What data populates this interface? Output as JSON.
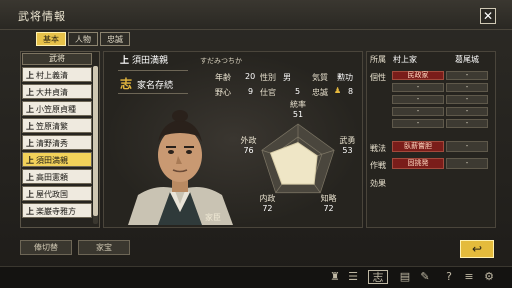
{
  "window": {
    "title": "武将情報",
    "close_label": "✕"
  },
  "tabs": [
    {
      "label": "基本",
      "active": true
    },
    {
      "label": "人物",
      "active": false
    },
    {
      "label": "忠誠",
      "active": false
    }
  ],
  "officer_list": {
    "header": "武将",
    "mark": "上",
    "items": [
      {
        "name": "村上義清",
        "selected": false
      },
      {
        "name": "大井貞清",
        "selected": false
      },
      {
        "name": "小笠原貞種",
        "selected": false
      },
      {
        "name": "笠原清繁",
        "selected": false
      },
      {
        "name": "清野清秀",
        "selected": false
      },
      {
        "name": "須田満親",
        "selected": true
      },
      {
        "name": "高田憲頼",
        "selected": false
      },
      {
        "name": "屋代政国",
        "selected": false
      },
      {
        "name": "楽巌寺雅方",
        "selected": false
      }
    ]
  },
  "officer": {
    "mark": "上",
    "name": "須田満親",
    "kana": "すだみつちか",
    "family_icon": "志",
    "family_text": "家名存続",
    "stats": [
      {
        "label": "年齢",
        "value": "20"
      },
      {
        "label": "性別",
        "value": "男"
      },
      {
        "label": "気質",
        "value": "勲功"
      },
      {
        "label": "野心",
        "value": "9"
      },
      {
        "label": "仕官",
        "value": "5"
      },
      {
        "label": "忠誠",
        "value": "8"
      }
    ],
    "portrait_caption": "家臣"
  },
  "radar": {
    "axes": [
      {
        "label": "統率",
        "value": 51
      },
      {
        "label": "武勇",
        "value": 53
      },
      {
        "label": "知略",
        "value": 72
      },
      {
        "label": "内政",
        "value": 72
      },
      {
        "label": "外政",
        "value": 76
      }
    ]
  },
  "affiliation": {
    "clan_label": "所属",
    "clan_value": "村上家",
    "castle_value": "葛尾城"
  },
  "traits": {
    "label": "個性",
    "cells": [
      [
        "民政家",
        "-"
      ],
      [
        "-",
        "-"
      ],
      [
        "-",
        "-"
      ],
      [
        "-",
        "-"
      ],
      [
        "-",
        "-"
      ]
    ]
  },
  "tactics": {
    "label": "戦法",
    "value": "臥薪嘗胆",
    "extra": "-"
  },
  "strategy": {
    "label": "作戦",
    "value": "固挑発",
    "extra": "-"
  },
  "effects": {
    "label": "効果"
  },
  "buttons": {
    "rank_change": "俸切替",
    "family_treasure": "家宝",
    "back": "↩"
  },
  "bottom_icons": [
    "chess-icon",
    "counter-icon",
    "scroll-icon",
    "list-icon",
    "edit-icon",
    "help-icon",
    "menu-icon",
    "gear-icon"
  ],
  "colors": {
    "accent": "#e7c24a",
    "selected_row": "#f2d25a",
    "trait_red": "#7a1d1a"
  }
}
